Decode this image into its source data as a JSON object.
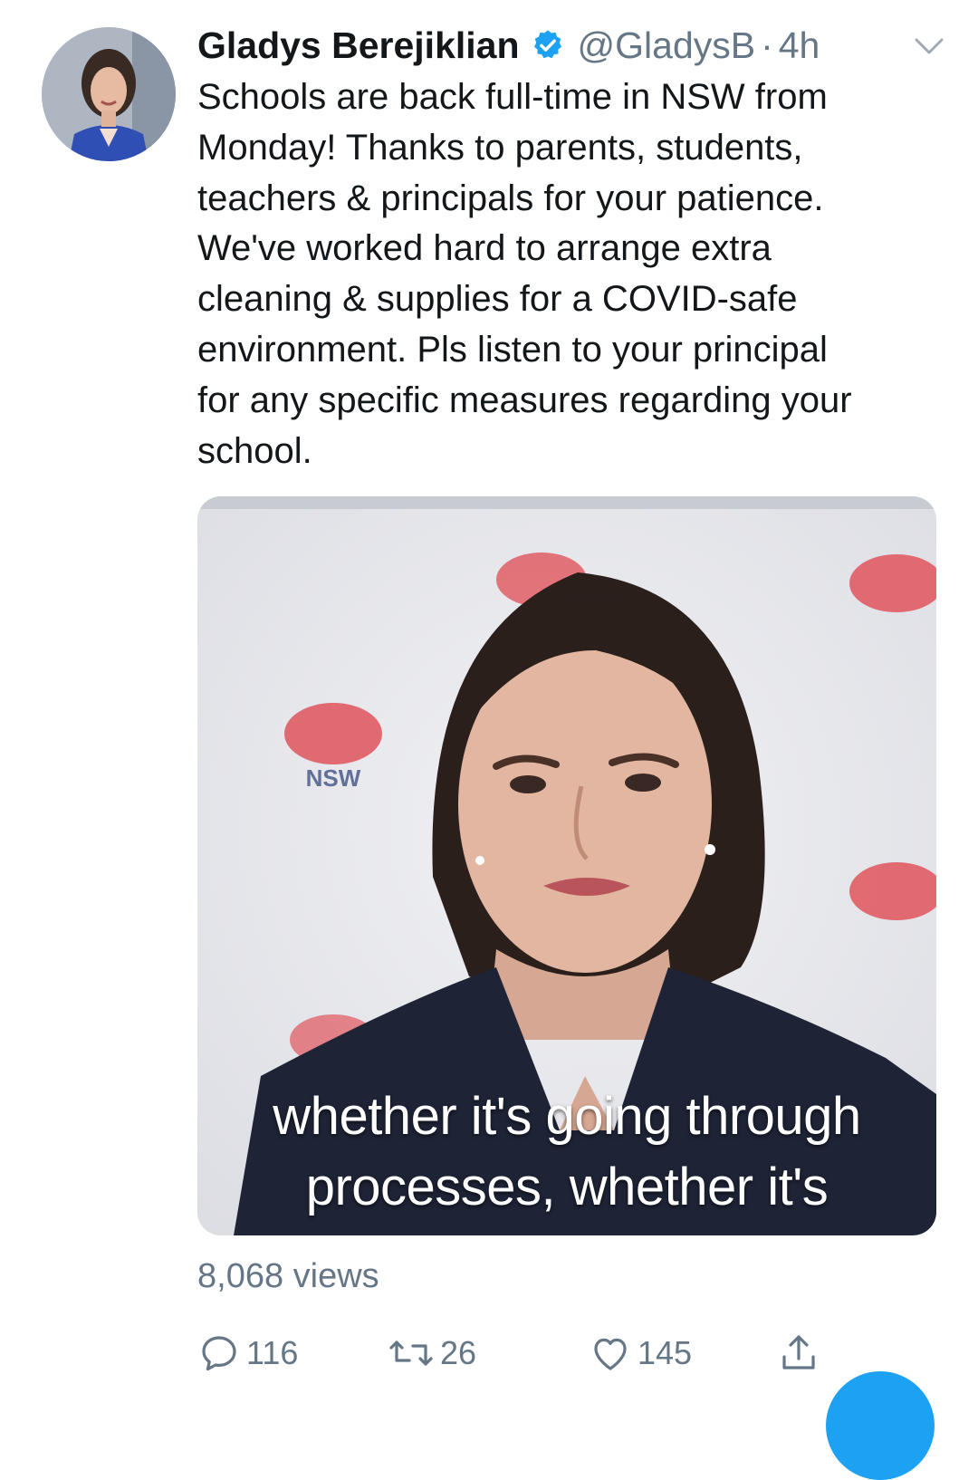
{
  "tweet": {
    "author_name": "Gladys Berejiklian",
    "handle": "@GladysB",
    "separator": "·",
    "time": "4h",
    "text": "Schools are back full-time in NSW from\nMonday! Thanks to parents, students,\nteachers & principals for your patience.\nWe've worked hard to arrange extra\ncleaning & supplies for a COVID-safe\nenvironment. Pls listen to your principal\nfor any specific measures regarding your\nschool.",
    "media": {
      "caption_line1": "whether it's going through",
      "caption_line2": "processes, whether it's",
      "logo_text": "NSW"
    },
    "views": "8,068 views",
    "actions": {
      "reply_count": "116",
      "retweet_count": "26",
      "like_count": "145"
    },
    "icons": {
      "verified": "verified-badge-icon",
      "caret": "chevron-down-icon",
      "reply": "reply-icon",
      "retweet": "retweet-icon",
      "like": "heart-icon",
      "share": "share-icon"
    },
    "colors": {
      "accent": "#1da1f2",
      "muted": "#657786",
      "text": "#14171a"
    }
  }
}
